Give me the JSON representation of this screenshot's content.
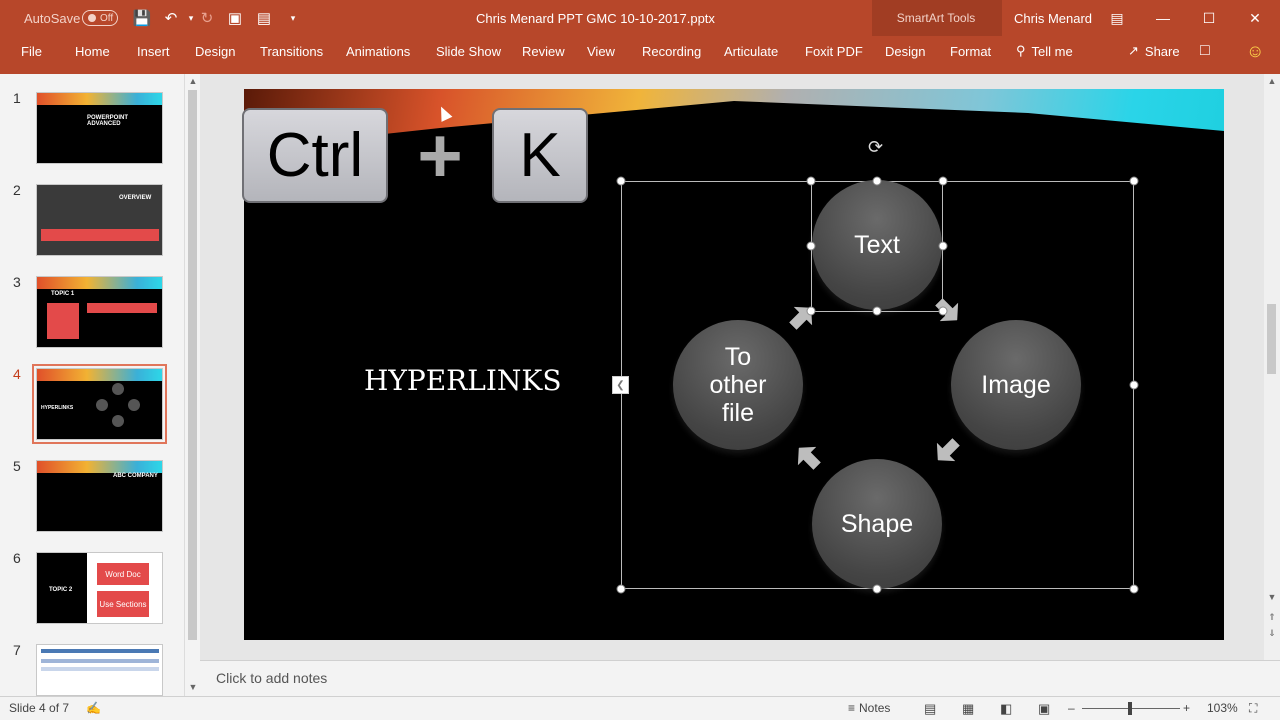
{
  "titlebar": {
    "autosave_label": "AutoSave",
    "autosave_state": "Off",
    "doc_title": "Chris Menard PPT GMC 10-10-2017.pptx",
    "contextual_group": "SmartArt Tools",
    "user_name": "Chris Menard",
    "icons": [
      "save-icon",
      "undo-icon",
      "redo-icon",
      "present-icon",
      "screenshot-icon",
      "customize-icon"
    ]
  },
  "ribbon": {
    "tabs": [
      "File",
      "Home",
      "Insert",
      "Design",
      "Transitions",
      "Animations",
      "Slide Show",
      "Review",
      "View",
      "Recording",
      "Articulate",
      "Foxit PDF",
      "Design",
      "Format"
    ],
    "tell_me": "Tell me",
    "share": "Share"
  },
  "thumbnails": [
    {
      "num": "1",
      "caption": "POWERPOINT ADVANCED"
    },
    {
      "num": "2",
      "caption": "OVERVIEW"
    },
    {
      "num": "3",
      "caption": "TOPIC 1"
    },
    {
      "num": "4",
      "caption": "HYPERLINKS"
    },
    {
      "num": "5",
      "caption": "ABC COMPANY"
    },
    {
      "num": "6",
      "caption": "TOPIC 2",
      "btn1": "Word Doc",
      "btn2": "Use Sections"
    },
    {
      "num": "7",
      "caption": ""
    }
  ],
  "slide": {
    "key1": "Ctrl",
    "plus": "+",
    "key2": "K",
    "title": "HYPERLINKS",
    "nodes": {
      "top": "Text",
      "right": "Image",
      "bottom": "Shape",
      "left_l1": "To",
      "left_l2": "other",
      "left_l3": "file"
    }
  },
  "notes": {
    "placeholder": "Click to add notes"
  },
  "status": {
    "slide_info": "Slide 4 of 7",
    "notes_btn": "Notes",
    "zoom": "103%"
  },
  "colors": {
    "accent": "#b7472a",
    "slide_bg": "#000000",
    "node": "#555555"
  }
}
